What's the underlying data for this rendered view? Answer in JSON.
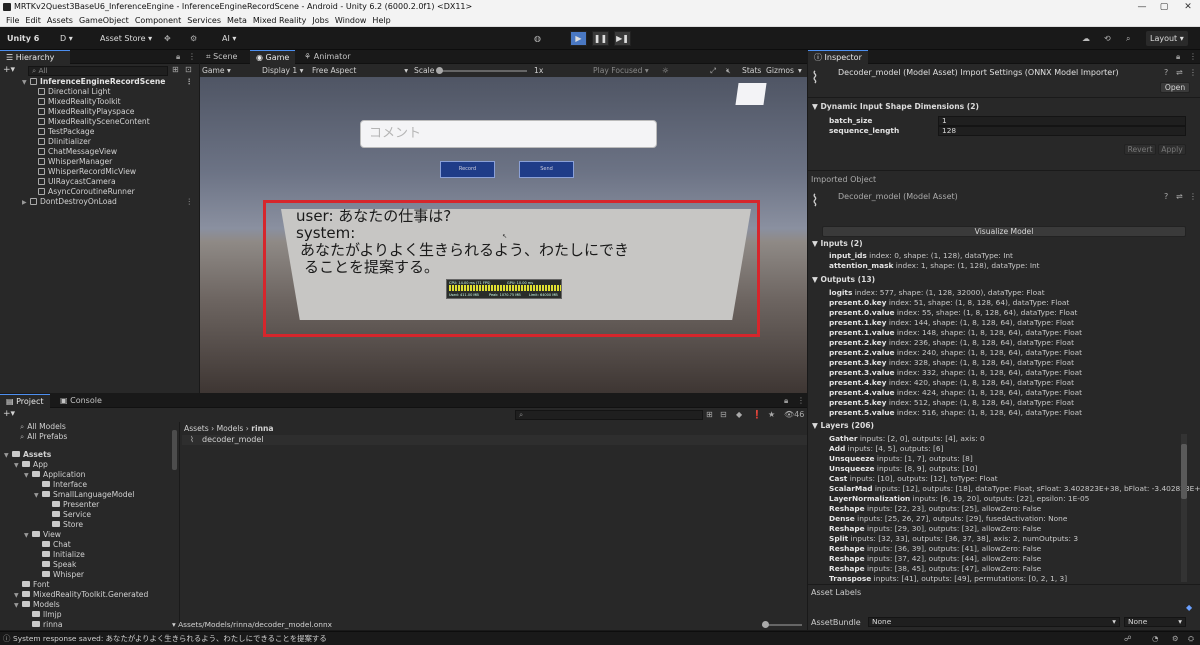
{
  "window": {
    "title": "MRTKv2Quest3BaseU6_InferenceEngine - InferenceEngineRecordScene - Android - Unity 6.2 (6000.2.0f1) <DX11>",
    "minimize": "—",
    "maximize": "▢",
    "close": "✕"
  },
  "menu": [
    "File",
    "Edit",
    "Assets",
    "GameObject",
    "Component",
    "Services",
    "Meta",
    "Mixed Reality",
    "Jobs",
    "Window",
    "Help"
  ],
  "toolbar": {
    "unity": "Unity 6",
    "account": "D ▾",
    "asset_store": "Asset Store ▾",
    "ai": "AI ▾",
    "layout": "Layout ▾",
    "play": "▶",
    "pause": "❚❚",
    "step": "▶❚"
  },
  "hierarchy": {
    "tab": "Hierarchy",
    "search_placeholder": "All",
    "scene": "InferenceEngineRecordScene",
    "items": [
      "Directional Light",
      "MixedRealityToolkit",
      "MixedRealityPlayspace",
      "MixedRealitySceneContent",
      "TestPackage",
      "DIinitializer",
      "ChatMessageView",
      "WhisperManager",
      "WhisperRecordMicView",
      "UIRaycastCamera",
      "AsyncCoroutineRunner"
    ],
    "dont_destroy": "DontDestroyOnLoad"
  },
  "scene_tabs": {
    "scene": "Scene",
    "game": "Game",
    "animator": "Animator"
  },
  "game_toolbar": {
    "mode": "Game",
    "display": "Display 1",
    "aspect": "Free Aspect",
    "scale_label": "Scale",
    "scale_value": "1x",
    "play_focused": "Play Focused",
    "stats": "Stats",
    "gizmos": "Gizmos"
  },
  "game_view": {
    "comment_placeholder": "コメント",
    "btn1": "Record",
    "btn2": "Send",
    "chat_line1": "user: あなたの仕事は?",
    "chat_line2": "system:",
    "chat_line3": "あなたがよりよく生きられるよう、わたしにでき",
    "chat_line4": "ることを提案する。",
    "stats_line1": "CPU: 14.00 ms (71 FPS)",
    "stats_line2": "GPU: 10.00 ms",
    "stats_line3": "Used: 411.00 MB",
    "stats_line4": "Peak: 1070.75 MB",
    "stats_line5": "Limit: 64000 MB",
    "highlight_color": "#d6262c"
  },
  "inspector": {
    "tab": "Inspector",
    "title": "Decoder_model (Model Asset) Import Settings (ONNX Model Importer)",
    "open": "Open",
    "dynamic_header": "Dynamic Input Shape Dimensions (2)",
    "batch_size_label": "batch_size",
    "batch_size_value": "1",
    "seq_len_label": "sequence_length",
    "seq_len_value": "128",
    "revert": "Revert",
    "apply": "Apply",
    "imported_object": "Imported Object",
    "asset_name": "Decoder_model (Model Asset)",
    "visualize": "Visualize Model",
    "inputs_header": "Inputs (2)",
    "inputs": [
      {
        "name": "input_ids",
        "desc": " index: 0, shape: (1, 128), dataType: Int"
      },
      {
        "name": "attention_mask",
        "desc": " index: 1, shape: (1, 128), dataType: Int"
      }
    ],
    "outputs_header": "Outputs (13)",
    "outputs": [
      {
        "name": "logits",
        "desc": " index: 577, shape: (1, 128, 32000), dataType: Float"
      },
      {
        "name": "present.0.key",
        "desc": " index: 51, shape: (1, 8, 128, 64), dataType: Float"
      },
      {
        "name": "present.0.value",
        "desc": " index: 55, shape: (1, 8, 128, 64), dataType: Float"
      },
      {
        "name": "present.1.key",
        "desc": " index: 144, shape: (1, 8, 128, 64), dataType: Float"
      },
      {
        "name": "present.1.value",
        "desc": " index: 148, shape: (1, 8, 128, 64), dataType: Float"
      },
      {
        "name": "present.2.key",
        "desc": " index: 236, shape: (1, 8, 128, 64), dataType: Float"
      },
      {
        "name": "present.2.value",
        "desc": " index: 240, shape: (1, 8, 128, 64), dataType: Float"
      },
      {
        "name": "present.3.key",
        "desc": " index: 328, shape: (1, 8, 128, 64), dataType: Float"
      },
      {
        "name": "present.3.value",
        "desc": " index: 332, shape: (1, 8, 128, 64), dataType: Float"
      },
      {
        "name": "present.4.key",
        "desc": " index: 420, shape: (1, 8, 128, 64), dataType: Float"
      },
      {
        "name": "present.4.value",
        "desc": " index: 424, shape: (1, 8, 128, 64), dataType: Float"
      },
      {
        "name": "present.5.key",
        "desc": " index: 512, shape: (1, 8, 128, 64), dataType: Float"
      },
      {
        "name": "present.5.value",
        "desc": " index: 516, shape: (1, 8, 128, 64), dataType: Float"
      }
    ],
    "layers_header": "Layers (206)",
    "layers": [
      {
        "name": "Gather",
        "desc": " inputs: [2, 0], outputs: [4], axis: 0"
      },
      {
        "name": "Add",
        "desc": " inputs: [4, 5], outputs: [6]"
      },
      {
        "name": "Unsqueeze",
        "desc": " inputs: [1, 7], outputs: [8]"
      },
      {
        "name": "Unsqueeze",
        "desc": " inputs: [8, 9], outputs: [10]"
      },
      {
        "name": "Cast",
        "desc": " inputs: [10], outputs: [12], toType: Float"
      },
      {
        "name": "ScalarMad",
        "desc": " inputs: [12], outputs: [18], dataType: Float, sFloat: 3.402823E+38, bFloat: -3.402823E+"
      },
      {
        "name": "LayerNormalization",
        "desc": " inputs: [6, 19, 20], outputs: [22], epsilon: 1E-05"
      },
      {
        "name": "Reshape",
        "desc": " inputs: [22, 23], outputs: [25], allowZero: False"
      },
      {
        "name": "Dense",
        "desc": " inputs: [25, 26, 27], outputs: [29], fusedActivation: None"
      },
      {
        "name": "Reshape",
        "desc": " inputs: [29, 30], outputs: [32], allowZero: False"
      },
      {
        "name": "Split",
        "desc": " inputs: [32, 33], outputs: [36, 37, 38], axis: 2, numOutputs: 3"
      },
      {
        "name": "Reshape",
        "desc": " inputs: [36, 39], outputs: [41], allowZero: False"
      },
      {
        "name": "Reshape",
        "desc": " inputs: [37, 42], outputs: [44], allowZero: False"
      },
      {
        "name": "Reshape",
        "desc": " inputs: [38, 45], outputs: [47], allowZero: False"
      },
      {
        "name": "Transpose",
        "desc": " inputs: [41], outputs: [49], permutations: [0, 2, 1, 3]"
      }
    ],
    "asset_labels": "Asset Labels",
    "asset_bundle": "AssetBundle",
    "bundle_value": "None",
    "bundle_variant": "None"
  },
  "project": {
    "tab_project": "Project",
    "tab_console": "Console",
    "favorites": [
      "All Models",
      "All Prefabs"
    ],
    "tree": [
      {
        "label": "Assets",
        "indent": 0,
        "bold": true
      },
      {
        "label": "App",
        "indent": 1
      },
      {
        "label": "Application",
        "indent": 2
      },
      {
        "label": "Interface",
        "indent": 3
      },
      {
        "label": "SmallLanguageModel",
        "indent": 3
      },
      {
        "label": "Presenter",
        "indent": 4
      },
      {
        "label": "Service",
        "indent": 4
      },
      {
        "label": "Store",
        "indent": 4
      },
      {
        "label": "View",
        "indent": 2
      },
      {
        "label": "Chat",
        "indent": 3
      },
      {
        "label": "Initialize",
        "indent": 3
      },
      {
        "label": "Speak",
        "indent": 3
      },
      {
        "label": "Whisper",
        "indent": 3
      },
      {
        "label": "Font",
        "indent": 1
      },
      {
        "label": "MixedRealityToolkit.Generated",
        "indent": 1
      },
      {
        "label": "Models",
        "indent": 1
      },
      {
        "label": "llmjp",
        "indent": 2
      },
      {
        "label": "rinna",
        "indent": 2
      }
    ],
    "breadcrumb": [
      "Assets",
      "Models",
      "rinna"
    ],
    "file": "decoder_model",
    "footer_path": "Assets/Models/rinna/decoder_model.onnx",
    "hidden_count": "46"
  },
  "status": {
    "message": "System response saved: あなたがよりよく生きられるよう、わたしにできることを提案する"
  }
}
